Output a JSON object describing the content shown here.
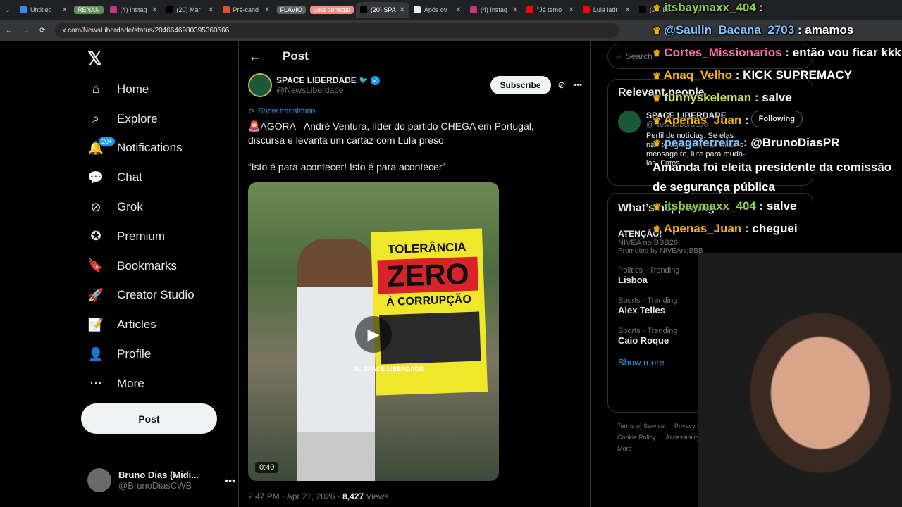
{
  "tabs": [
    {
      "label": "Untitled",
      "color": "#4285f4"
    },
    {
      "label": "RENAN",
      "group": true,
      "color": "#5f8e5b"
    },
    {
      "label": "(4) Instag",
      "color": "#c13584"
    },
    {
      "label": "(20) Mar",
      "color": "#000000"
    },
    {
      "label": "Pré-cand",
      "color": "#d9542b"
    },
    {
      "label": "FLAVIO",
      "group": true,
      "color": "#5f6368"
    },
    {
      "label": "Lula portugal",
      "group": true,
      "color": "#f28b82"
    },
    {
      "label": "(20) SPAC",
      "active": true,
      "color": "#000000"
    },
    {
      "label": "Após ov",
      "color": "#e8eaed"
    },
    {
      "label": "(4) Instag",
      "color": "#c13584"
    },
    {
      "label": "\"Já temo",
      "color": "#ff0000"
    },
    {
      "label": "Lula ladr",
      "color": "#ff0000"
    },
    {
      "label": "(20) Bru",
      "color": "#000000"
    }
  ],
  "address": {
    "url": "x.com/NewsLiberdade/status/2046646980395360566"
  },
  "sidebar": {
    "items": [
      {
        "label": "Home",
        "icon": "home-icon"
      },
      {
        "label": "Explore",
        "icon": "search-icon"
      },
      {
        "label": "Notifications",
        "icon": "bell-icon",
        "badge": "20+"
      },
      {
        "label": "Chat",
        "icon": "chat-icon"
      },
      {
        "label": "Grok",
        "icon": "grok-icon"
      },
      {
        "label": "Premium",
        "icon": "premium-icon"
      },
      {
        "label": "Bookmarks",
        "icon": "bookmark-icon"
      },
      {
        "label": "Creator Studio",
        "icon": "rocket-icon"
      },
      {
        "label": "Articles",
        "icon": "article-icon"
      },
      {
        "label": "Profile",
        "icon": "person-icon"
      },
      {
        "label": "More",
        "icon": "more-icon"
      }
    ],
    "post_label": "Post",
    "user": {
      "name": "Bruno Dias (Midi...",
      "handle": "@BrunoDiasCWB"
    }
  },
  "post": {
    "header_title": "Post",
    "author": "SPACE LIBERDADE",
    "handle": "@NewsLiberdade",
    "subscribe": "Subscribe",
    "show_translation": "Show translation",
    "text1": "🚨AGORA - André Ventura, líder do partido CHEGA em Portugal, discursa e levanta um cartaz com Lula preso",
    "text2": "“Isto é para acontecer! Isto é para acontecer”",
    "video": {
      "sign_top": "TOLERÂNCIA",
      "sign_mid": "ZERO",
      "sign_bot": "À CORRUPÇÃO",
      "watermark": "SL SPACE LIBERDADE",
      "duration": "0:40"
    },
    "meta": {
      "time": "2:47 PM · Apr 21, 2026 ·",
      "views": "8,427",
      "views_label": "Views"
    }
  },
  "right": {
    "search_placeholder": "Search",
    "relevant_title": "Relevant people",
    "relevant": {
      "name": "SPACE LIBERDADE",
      "handle": "@NewsLiberdade",
      "following": "Following",
      "bio": "Perfil de notícias. Se elas não te agradam, não mate o mensageiro, lute para mudá-las. Fatos."
    },
    "happening_title": "What’s happening",
    "promo": {
      "title": "ATENÇÃO!",
      "sub": "NIVEA no BBB26",
      "promoted": "Promoted by NIVEAnoBBB"
    },
    "trends": [
      {
        "cat": "Politics · Trending",
        "name": "Lisboa"
      },
      {
        "cat": "Sports · Trending",
        "name": "Alex Telles"
      },
      {
        "cat": "Sports · Trending",
        "name": "Caio Roque"
      }
    ],
    "show_more": "Show more",
    "footer": [
      "Terms of Service",
      "Privacy Policy",
      "Cookie Policy",
      "Accessibility",
      "Ads info",
      "More"
    ]
  },
  "chat": [
    {
      "user": "itsbaymaxx_404",
      "msg": "",
      "color": "#8fd14f"
    },
    {
      "user": "@Saulin_Bacana_2703",
      "msg": "amamos",
      "color": "#7cc4ff"
    },
    {
      "user": "Cortes_Missionarios",
      "msg": "então vou ficar kkk",
      "color": "#ff6ea8"
    },
    {
      "user": "Anaq_Velho",
      "msg": "KICK SUPREMACY",
      "color": "#f5b400"
    },
    {
      "user": "funnyskeleman",
      "msg": "salve",
      "color": "#d0e35a"
    },
    {
      "user": "Apenas_Juan",
      "msg": "",
      "color": "#f5b400"
    },
    {
      "user": "peagaferreira",
      "msg": "@BrunoDiasPR",
      "color": "#7cc4ff"
    },
    {
      "user": "",
      "msg": "Amanda foi eleita presidente da comissão de segurança pública",
      "color": "#ffffff"
    },
    {
      "user": "itsbaymaxx_404",
      "msg": "salve",
      "color": "#8fd14f"
    },
    {
      "user": "Apenas_Juan",
      "msg": "cheguei",
      "color": "#f5b400"
    }
  ]
}
